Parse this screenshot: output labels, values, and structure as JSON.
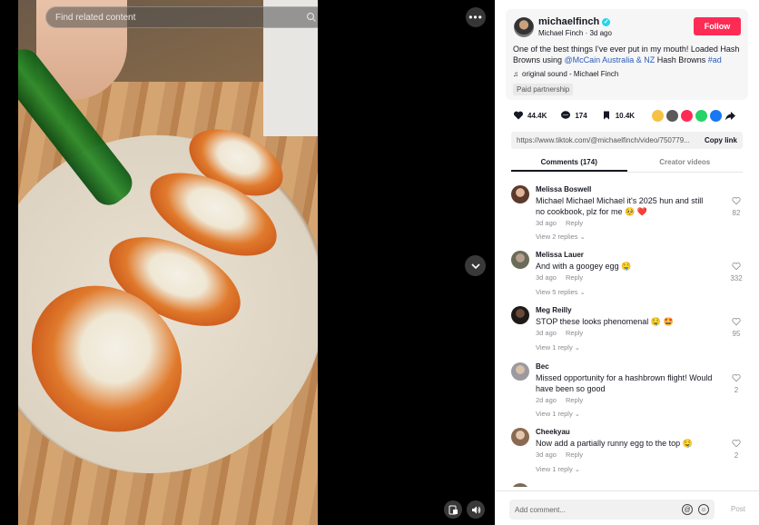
{
  "video": {
    "search_placeholder": "Find related content",
    "more_label": "•••"
  },
  "post": {
    "author_handle": "michaelfinch",
    "author_name": "Michael Finch",
    "time_ago": "3d ago",
    "follow_label": "Follow",
    "caption_pre": "One of the best things I've ever put in my mouth! Loaded Hash Browns using ",
    "caption_mention": "@McCain Australia & NZ",
    "caption_mid": " Hash Browns ",
    "caption_tag": "#ad",
    "sound": "original sound - Michael Finch",
    "partnership": "Paid partnership"
  },
  "actions": {
    "likes": "44.4K",
    "comments": "174",
    "saves": "10.4K"
  },
  "share_colors": [
    "#f6c245",
    "#5a5a5a",
    "#fe2c55",
    "#25d366",
    "#1877f2"
  ],
  "link": {
    "url": "https://www.tiktok.com/@michaelfinch/video/750779...",
    "copy_label": "Copy link"
  },
  "tabs": [
    {
      "label": "Comments (174)"
    },
    {
      "label": "Creator videos"
    }
  ],
  "comments": [
    {
      "user": "Melissa Boswell",
      "text": "Michael Michael Michael it's 2025 hun and still no cookbook, plz for me 🥺 ❤️",
      "time": "3d ago",
      "reply": "Reply",
      "replies": "View 2 replies",
      "likes": "82"
    },
    {
      "user": "Melissa Lauer",
      "text": "And with a googey egg 🤤",
      "time": "3d ago",
      "reply": "Reply",
      "replies": "View 5 replies",
      "likes": "332"
    },
    {
      "user": "Meg Reilly",
      "text": "STOP these looks phenomenal 🤤 🤩",
      "time": "3d ago",
      "reply": "Reply",
      "replies": "View 1 reply",
      "likes": "95"
    },
    {
      "user": "Bec",
      "text": "Missed opportunity for a hashbrown flight! Would have been so good",
      "time": "2d ago",
      "reply": "Reply",
      "replies": "View 1 reply",
      "likes": "2"
    },
    {
      "user": "Cheekyau",
      "text": "Now add a partially runny egg to the top 🤤",
      "time": "3d ago",
      "reply": "Reply",
      "replies": "View 1 reply",
      "likes": "2"
    }
  ],
  "comment_box": {
    "placeholder": "Add comment...",
    "mention_icon": "@",
    "post_label": "Post"
  }
}
